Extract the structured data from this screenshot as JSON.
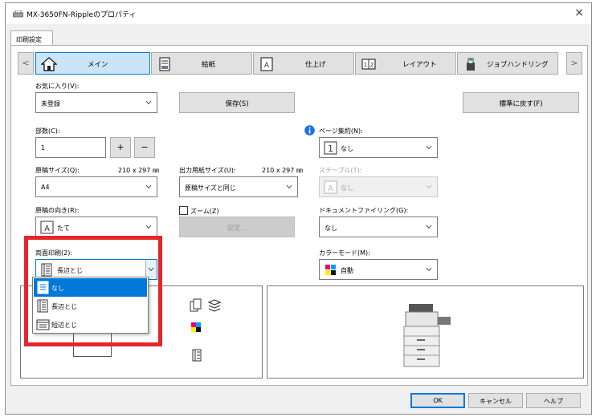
{
  "window": {
    "title": "MX-3650FN-Rippleのプロパティ",
    "close_glyph": "×"
  },
  "tabs": [
    {
      "label": "印刷設定"
    }
  ],
  "toolbar": {
    "prev_glyph": "<",
    "next_glyph": ">",
    "items": [
      {
        "label": "メイン",
        "icon": "home-icon"
      },
      {
        "label": "給紙",
        "icon": "paper-tray-icon"
      },
      {
        "label": "仕上げ",
        "icon": "finishing-icon"
      },
      {
        "label": "レイアウト",
        "icon": "layout-icon"
      },
      {
        "label": "ジョブハンドリング",
        "icon": "job-handling-icon"
      }
    ]
  },
  "favorites": {
    "label": "お気に入り(V):",
    "value": "未登録",
    "save_label": "保存(S)",
    "reset_label": "標準に戻す(F)"
  },
  "copies": {
    "label": "部数(C):",
    "value": "1",
    "plus": "+",
    "minus": "−"
  },
  "original_size": {
    "label": "原稿サイズ(Q):",
    "dims": "210 x 297 ㎜",
    "value": "A4"
  },
  "output_size": {
    "label": "出力用紙サイズ(U):",
    "dims": "210 x 297 ㎜",
    "value": "原稿サイズと同じ"
  },
  "orientation": {
    "label": "原稿の向き(R):",
    "value": "たて",
    "icon_glyph": "A"
  },
  "zoom": {
    "label": "ズーム(Z)",
    "settings_label": "設定..."
  },
  "pages_per_sheet": {
    "label": "ページ集約(N):",
    "value": "なし",
    "icon_glyph": "1"
  },
  "staple": {
    "label": "ステープル(T):",
    "value": "なし",
    "icon_glyph": "A"
  },
  "doc_filing": {
    "label": "ドキュメントファイリング(G):",
    "value": "なし"
  },
  "color_mode": {
    "label": "カラーモード(M):",
    "value": "自動"
  },
  "duplex": {
    "label": "両面印刷(2):",
    "value": "長辺とじ",
    "options": [
      {
        "label": "なし",
        "selected": true
      },
      {
        "label": "長辺とじ",
        "selected": false
      },
      {
        "label": "短辺とじ",
        "selected": false
      }
    ]
  },
  "footer": {
    "ok": "OK",
    "cancel": "キャンセル",
    "help": "ヘルプ"
  },
  "colors": {
    "accent": "#0078d7",
    "highlight": "#e3262d",
    "info": "#1a73e8"
  }
}
